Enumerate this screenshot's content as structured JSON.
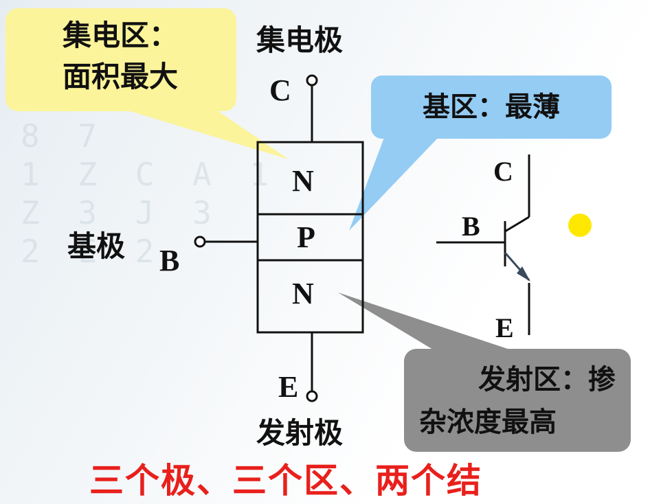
{
  "callouts": {
    "collector_region": {
      "line1": "集电区：",
      "line2": "面积最大"
    },
    "base_region": {
      "text": "基区：最薄"
    },
    "emitter_region": {
      "line1": "发射区：掺",
      "line2": "杂浓度最高"
    }
  },
  "electrodes": {
    "collector": {
      "name": "集电极",
      "letter": "C"
    },
    "base": {
      "name": "基极",
      "letter": "B"
    },
    "emitter": {
      "name": "发射极",
      "letter": "E"
    }
  },
  "layers": {
    "top": "N",
    "middle": "P",
    "bottom": "N"
  },
  "symbol": {
    "c": "C",
    "b": "B",
    "e": "E"
  },
  "footer": "三个极、三个区、两个结",
  "colors": {
    "yellow_callout": "#fbf49a",
    "blue_callout": "#94ccf4",
    "gray_callout": "#8e8e8e",
    "footer_red": "#e8201c",
    "dot_yellow": "#ffe800"
  }
}
